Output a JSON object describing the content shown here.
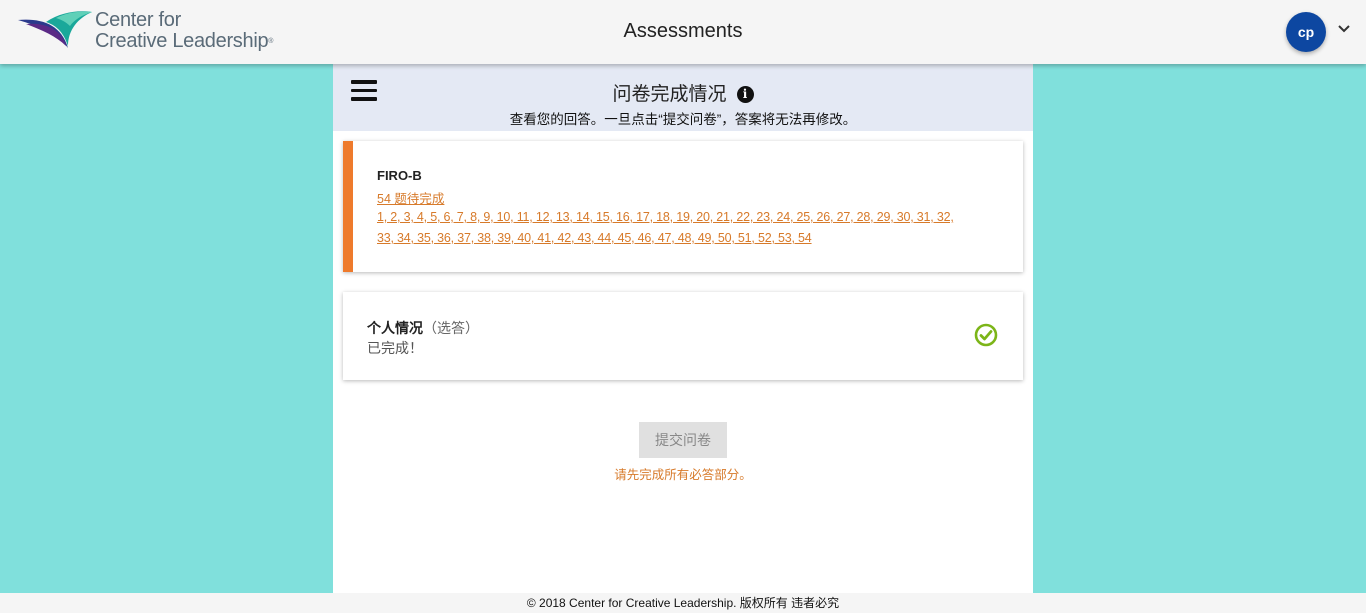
{
  "brand": {
    "line1": "Center for",
    "line2": "Creative Leadership",
    "colors": {
      "teal": "#1aa89a",
      "navy": "#2b3a8c",
      "purple": "#5b2a86"
    }
  },
  "app_title": "Assessments",
  "user": {
    "initials": "cp",
    "avatar_color": "#0d47a1"
  },
  "page": {
    "title": "问卷完成情况",
    "subtitle": "查看您的回答。一旦点击“提交问卷”，答案将无法再修改。"
  },
  "firo": {
    "name": "FIRO-B",
    "pending": "54 题待完成",
    "accent": "#ee7a2c",
    "items_line1": "1, 2, 3, 4, 5, 6, 7, 8, 9, 10, 11, 12, 13, 14, 15, 16, 17, 18, 19, 20, 21, 22, 23, 24, 25, 26, 27, 28, 29, 30, 31, 32,",
    "items_line2": "33, 34, 35, 36, 37, 38, 39, 40, 41, 42, 43, 44, 45, 46, 47, 48, 49, 50, 51, 52, 53, 54"
  },
  "personal": {
    "name": "个人情况",
    "optional": "（选答）",
    "status": "已完成！",
    "check_color": "#7cb518"
  },
  "submit": {
    "label": "提交问卷",
    "hint": "请先完成所有必答部分。"
  },
  "footer": "© 2018 Center for Creative Leadership. 版权所有 违者必究"
}
